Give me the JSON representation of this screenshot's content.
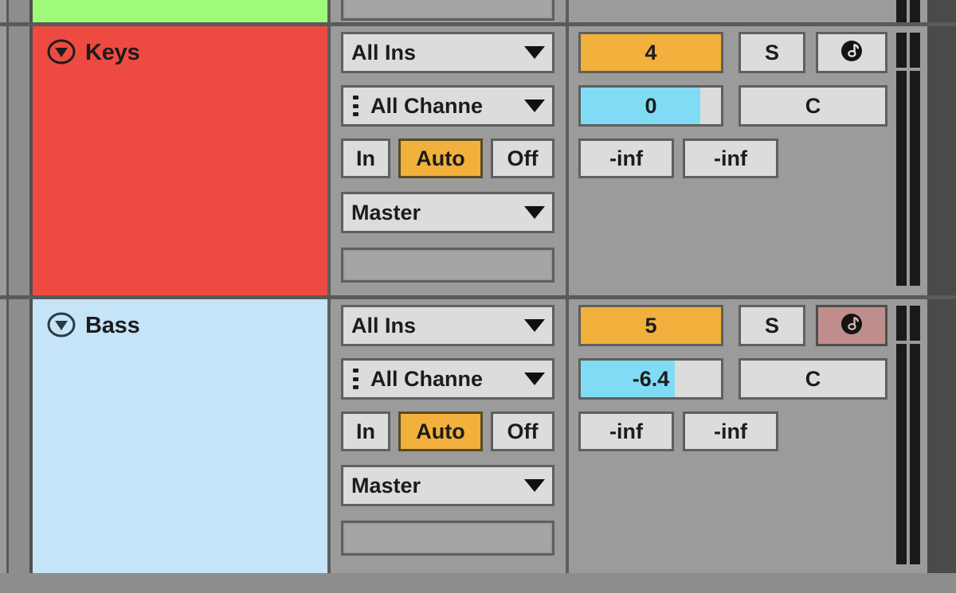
{
  "app": {
    "name": "ableton-session-mixer"
  },
  "colors": {
    "panel_bg": "#9b9b9b",
    "outer_bg": "#4a4a4a",
    "accent_orange": "#F2B03C",
    "accent_blue": "#7FDCF4",
    "arm_active": "#C08D8D",
    "widget_bg": "#dcdcdc",
    "border": "#5f5f5f"
  },
  "tracks": [
    {
      "id": "track-green-partial",
      "name": "",
      "color": "#A0FA7A",
      "partial": true,
      "fold_icon": "triangle-down-circle-icon",
      "io": {
        "input_type": "",
        "input_channel": "",
        "monitor": {
          "in_label": "",
          "auto_label": "",
          "off_label": "",
          "selected": ""
        },
        "output_type": "",
        "crossfade_slot": ""
      },
      "mixer": {
        "track_number": "",
        "solo_label": "",
        "arm_icon": "record-arm-midi-icon",
        "arm_active": false,
        "volume_value": "",
        "volume_fill_pct": 0,
        "pan_value": "",
        "send_a": "",
        "send_b": "",
        "meter_left_pct": 0,
        "meter_right_pct": 0
      }
    },
    {
      "id": "track-keys",
      "name": "Keys",
      "color": "#EE4A41",
      "partial": false,
      "fold_icon": "triangle-down-circle-icon",
      "io": {
        "input_type": "All Ins",
        "input_channel": "All Channe",
        "monitor": {
          "in_label": "In",
          "auto_label": "Auto",
          "off_label": "Off",
          "selected": "Auto"
        },
        "output_type": "Master",
        "crossfade_slot": ""
      },
      "mixer": {
        "track_number": "4",
        "solo_label": "S",
        "arm_icon": "record-arm-midi-icon",
        "arm_active": false,
        "volume_value": "0",
        "volume_fill_pct": 85,
        "pan_value": "C",
        "send_a": "-inf",
        "send_b": "-inf",
        "meter_left_pct": 0,
        "meter_right_pct": 0
      }
    },
    {
      "id": "track-bass",
      "name": "Bass",
      "color": "#C5E4F8",
      "partial": false,
      "fold_icon": "triangle-down-circle-icon",
      "io": {
        "input_type": "All Ins",
        "input_channel": "All Channe",
        "monitor": {
          "in_label": "In",
          "auto_label": "Auto",
          "off_label": "Off",
          "selected": "Auto"
        },
        "output_type": "Master",
        "crossfade_slot": ""
      },
      "mixer": {
        "track_number": "5",
        "solo_label": "S",
        "arm_icon": "record-arm-midi-icon",
        "arm_active": true,
        "volume_value": "-6.4",
        "volume_fill_pct": 67,
        "pan_value": "C",
        "send_a": "-inf",
        "send_b": "-inf",
        "meter_left_pct": 0,
        "meter_right_pct": 0
      }
    }
  ]
}
